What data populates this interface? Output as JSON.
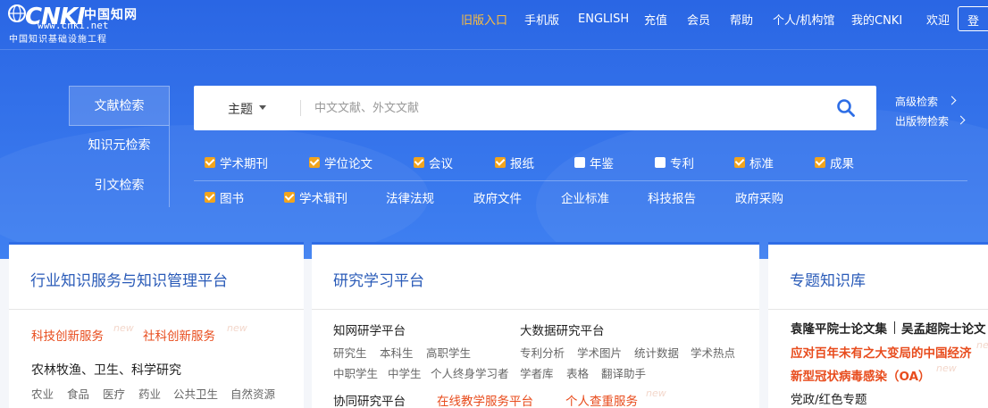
{
  "logo": {
    "brand": "CNKI",
    "chinese": "中国知网",
    "url": "www.cnki.net",
    "subtitle": "中国知识基础设施工程"
  },
  "nav": {
    "items": [
      "旧版入口",
      "手机版",
      "ENGLISH",
      "充值",
      "会员",
      "帮助",
      "个人/机构馆",
      "我的CNKI",
      "欢迎"
    ],
    "login": "登"
  },
  "side_tabs": [
    "文献检索",
    "知识元检索",
    "引文检索"
  ],
  "search": {
    "scope": "主题",
    "placeholder": "中文文献、外文文献"
  },
  "advanced": [
    "高级检索",
    "出版物检索"
  ],
  "filters_row1": [
    {
      "label": "学术期刊",
      "checked": true
    },
    {
      "label": "学位论文",
      "checked": true
    },
    {
      "label": "会议",
      "checked": true
    },
    {
      "label": "报纸",
      "checked": true
    },
    {
      "label": "年鉴",
      "checked": false
    },
    {
      "label": "专利",
      "checked": false
    },
    {
      "label": "标准",
      "checked": true
    },
    {
      "label": "成果",
      "checked": true
    }
  ],
  "filters_row2": [
    {
      "label": "图书",
      "checked": true
    },
    {
      "label": "学术辑刊",
      "checked": true
    },
    {
      "label": "法律法规"
    },
    {
      "label": "政府文件"
    },
    {
      "label": "企业标准"
    },
    {
      "label": "科技报告"
    },
    {
      "label": "政府采购"
    }
  ],
  "card1": {
    "title": "行业知识服务与知识管理平台",
    "links": [
      "科技创新服务",
      "社科创新服务"
    ],
    "new": "new",
    "section": "农林牧渔、卫生、科学研究",
    "tags": [
      "农业",
      "食品",
      "医疗",
      "药业",
      "公共卫生",
      "自然资源"
    ]
  },
  "card2": {
    "title": "研究学习平台",
    "col1_title": "知网研学平台",
    "col1_tags1": [
      "研究生",
      "本科生",
      "高职学生"
    ],
    "col1_tags2": [
      "中职学生",
      "中学生",
      "个人终身学习者"
    ],
    "col2_title": "大数据研究平台",
    "col2_tags1": [
      "专利分析",
      "学术图片",
      "统计数据",
      "学术热点"
    ],
    "col2_tags2": [
      "学者库",
      "表格",
      "翻译助手"
    ],
    "row3": [
      "协同研究平台",
      "在线教学服务平台",
      "个人查重服务"
    ],
    "new": "new"
  },
  "card3": {
    "title": "专题知识库",
    "line1a": "袁隆平院士论文集",
    "line1b": "吴孟超院士论文",
    "line2": "应对百年未有之大变局的中国经济",
    "line3": "新型冠状病毒感染（OA）",
    "line4": "党政/红色专题",
    "new": "new"
  }
}
